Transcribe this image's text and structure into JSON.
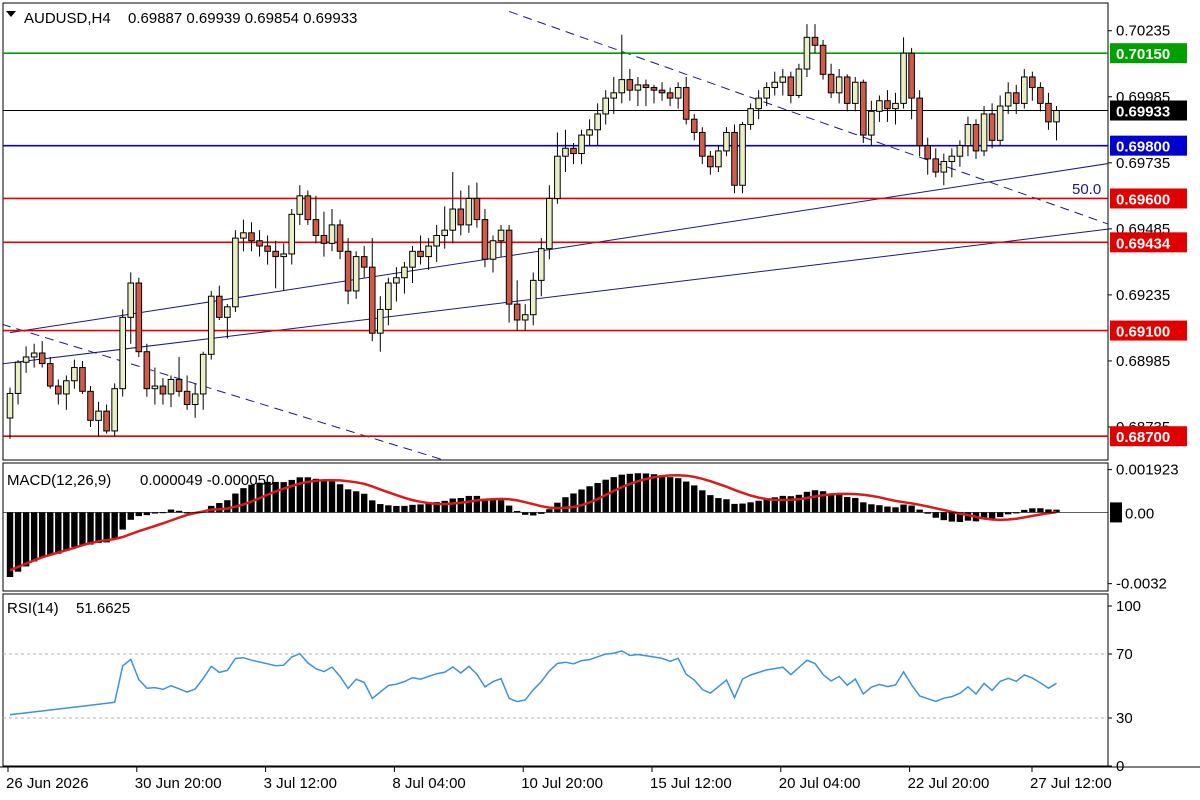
{
  "header": {
    "symbol": "AUDUSD,H4",
    "ohlc": "0.69887 0.69939 0.69854 0.69933",
    "menu_icon": "triangle-down-icon"
  },
  "colors": {
    "bull_body": "#e9efc6",
    "bear_body": "#cf5b49",
    "wick": "#000000",
    "resistance_line": "#e00000",
    "green_line": "#00a000",
    "blue_line": "#0000d0",
    "price_line": "#000000",
    "macd_signal": "#d81b1b",
    "rsi_line": "#3b93d9"
  },
  "chart_data": [
    {
      "type": "candlestick",
      "title": "AUDUSD,H4",
      "y_range": [
        0.6861,
        0.7034
      ],
      "y_ticks": [
        {
          "value": 0.70235,
          "label": "0.70235"
        },
        {
          "value": 0.69985,
          "label": "0.69985"
        },
        {
          "value": 0.69735,
          "label": "0.69735"
        },
        {
          "value": 0.69485,
          "label": "0.69485"
        },
        {
          "value": 0.69235,
          "label": "0.69235"
        },
        {
          "value": 0.68985,
          "label": "0.68985"
        },
        {
          "value": 0.68735,
          "label": "0.68735"
        }
      ],
      "x_labels": [
        "26 Jun 2026",
        "30 Jun 20:00",
        "3 Jul 12:00",
        "8 Jul 04:00",
        "10 Jul 20:00",
        "15 Jul 12:00",
        "20 Jul 04:00",
        "22 Jul 20:00",
        "27 Jul 12:00"
      ],
      "horizontal_levels": [
        {
          "value": 0.7015,
          "label": "0.70150",
          "color": "#00a000",
          "badge_bg": "#00a000",
          "badge_fg": "#ffffff"
        },
        {
          "value": 0.69933,
          "label": "0.69933",
          "color": "#000000",
          "badge_bg": "#000000",
          "badge_fg": "#ffffff"
        },
        {
          "value": 0.698,
          "label": "0.69800",
          "color": "#0000d0",
          "badge_bg": "#0000d0",
          "badge_fg": "#ffffff"
        },
        {
          "value": 0.696,
          "label": "0.69600",
          "color": "#e00000",
          "badge_bg": "#e00000",
          "badge_fg": "#ffffff"
        },
        {
          "value": 0.69434,
          "label": "0.69434",
          "color": "#e00000",
          "badge_bg": "#e00000",
          "badge_fg": "#ffffff"
        },
        {
          "value": 0.691,
          "label": "0.69100",
          "color": "#e00000",
          "badge_bg": "#e00000",
          "badge_fg": "#ffffff"
        },
        {
          "value": 0.687,
          "label": "0.68700",
          "color": "#e00000",
          "badge_bg": "#e00000",
          "badge_fg": "#ffffff"
        }
      ],
      "trend_lines": [
        {
          "from": [
            0,
            0.69092
          ],
          "to": [
            137,
            0.69735
          ],
          "color": "#1a1a80",
          "dash": false
        },
        {
          "from": [
            -2,
            0.6897
          ],
          "to": [
            144,
            0.69512
          ],
          "color": "#1a1a80",
          "dash": false,
          "note": "upper-channel hidden"
        },
        {
          "from": [
            62,
            0.70308
          ],
          "to": [
            138,
            0.69486
          ],
          "color": "#1a1a80",
          "dash": true
        },
        {
          "from": [
            -1,
            0.69124
          ],
          "to": [
            56,
            0.6859
          ],
          "color": "#1a1a80",
          "dash": true
        }
      ],
      "fib_label": "50.0",
      "candles": [
        [
          0.68769,
          0.68884,
          0.6869,
          0.68862
        ],
        [
          0.68862,
          0.68988,
          0.6882,
          0.6898
        ],
        [
          0.6898,
          0.6904,
          0.6894,
          0.69
        ],
        [
          0.69,
          0.6905,
          0.6896,
          0.69015
        ],
        [
          0.69015,
          0.6906,
          0.6896,
          0.68975
        ],
        [
          0.68975,
          0.69,
          0.6888,
          0.6889
        ],
        [
          0.6889,
          0.68915,
          0.6882,
          0.6886
        ],
        [
          0.6886,
          0.6893,
          0.688,
          0.6891
        ],
        [
          0.6891,
          0.6899,
          0.6888,
          0.6896
        ],
        [
          0.6896,
          0.68985,
          0.6886,
          0.6887
        ],
        [
          0.6887,
          0.6889,
          0.68735,
          0.6876
        ],
        [
          0.6876,
          0.6883,
          0.687,
          0.68795
        ],
        [
          0.68795,
          0.6882,
          0.6871,
          0.6872
        ],
        [
          0.6872,
          0.689,
          0.687,
          0.6888
        ],
        [
          0.6888,
          0.6918,
          0.6885,
          0.6915
        ],
        [
          0.6915,
          0.6932,
          0.6905,
          0.6928
        ],
        [
          0.6928,
          0.693,
          0.69,
          0.6902
        ],
        [
          0.6902,
          0.6905,
          0.6885,
          0.6888
        ],
        [
          0.6888,
          0.6896,
          0.6882,
          0.6889
        ],
        [
          0.6889,
          0.6892,
          0.6882,
          0.6886
        ],
        [
          0.6886,
          0.6893,
          0.6881,
          0.68915
        ],
        [
          0.68915,
          0.69,
          0.6885,
          0.6887
        ],
        [
          0.6887,
          0.6893,
          0.688,
          0.6882
        ],
        [
          0.6882,
          0.689,
          0.6877,
          0.6886
        ],
        [
          0.6886,
          0.6902,
          0.688,
          0.6901
        ],
        [
          0.6901,
          0.6925,
          0.6899,
          0.6923
        ],
        [
          0.6923,
          0.6927,
          0.6914,
          0.6915
        ],
        [
          0.6915,
          0.692,
          0.6907,
          0.6919
        ],
        [
          0.6919,
          0.6948,
          0.6917,
          0.6945
        ],
        [
          0.6945,
          0.6952,
          0.694,
          0.6947
        ],
        [
          0.6947,
          0.6951,
          0.694,
          0.6944
        ],
        [
          0.6944,
          0.6948,
          0.6938,
          0.6942
        ],
        [
          0.6942,
          0.6946,
          0.6935,
          0.694
        ],
        [
          0.694,
          0.6944,
          0.6926,
          0.6938
        ],
        [
          0.6938,
          0.6943,
          0.6925,
          0.6939
        ],
        [
          0.6939,
          0.6956,
          0.6935,
          0.6954
        ],
        [
          0.6954,
          0.6965,
          0.695,
          0.6961
        ],
        [
          0.6961,
          0.6963,
          0.695,
          0.6952
        ],
        [
          0.6952,
          0.6961,
          0.6943,
          0.6946
        ],
        [
          0.6946,
          0.6955,
          0.6938,
          0.6943
        ],
        [
          0.6943,
          0.6956,
          0.694,
          0.695
        ],
        [
          0.695,
          0.6952,
          0.6937,
          0.694
        ],
        [
          0.694,
          0.6945,
          0.692,
          0.6925
        ],
        [
          0.6925,
          0.694,
          0.6922,
          0.6938
        ],
        [
          0.6938,
          0.6942,
          0.693,
          0.6934
        ],
        [
          0.6934,
          0.6945,
          0.6906,
          0.6909
        ],
        [
          0.6909,
          0.6923,
          0.6902,
          0.6918
        ],
        [
          0.6918,
          0.693,
          0.6912,
          0.6928
        ],
        [
          0.6928,
          0.6934,
          0.6921,
          0.693
        ],
        [
          0.693,
          0.6936,
          0.6924,
          0.6934
        ],
        [
          0.6934,
          0.6942,
          0.6928,
          0.694
        ],
        [
          0.694,
          0.6946,
          0.6935,
          0.6938
        ],
        [
          0.6938,
          0.6945,
          0.6933,
          0.6942
        ],
        [
          0.6942,
          0.695,
          0.6936,
          0.6946
        ],
        [
          0.6946,
          0.6957,
          0.6941,
          0.6948
        ],
        [
          0.6948,
          0.697,
          0.6943,
          0.6956
        ],
        [
          0.6956,
          0.6963,
          0.6946,
          0.695
        ],
        [
          0.695,
          0.6965,
          0.6947,
          0.696
        ],
        [
          0.696,
          0.6966,
          0.6949,
          0.6952
        ],
        [
          0.6952,
          0.6956,
          0.6934,
          0.6937
        ],
        [
          0.6937,
          0.6946,
          0.6932,
          0.6944
        ],
        [
          0.6944,
          0.695,
          0.6938,
          0.6948
        ],
        [
          0.6948,
          0.695,
          0.6913,
          0.692
        ],
        [
          0.692,
          0.6929,
          0.691,
          0.6914
        ],
        [
          0.6914,
          0.692,
          0.691,
          0.6916
        ],
        [
          0.6916,
          0.6932,
          0.6912,
          0.6929
        ],
        [
          0.6929,
          0.6945,
          0.6923,
          0.6941
        ],
        [
          0.6941,
          0.6965,
          0.6937,
          0.696
        ],
        [
          0.696,
          0.6985,
          0.6958,
          0.6976
        ],
        [
          0.6976,
          0.6986,
          0.697,
          0.6979
        ],
        [
          0.6979,
          0.6981,
          0.6973,
          0.6977
        ],
        [
          0.6977,
          0.6986,
          0.6973,
          0.6984
        ],
        [
          0.6984,
          0.699,
          0.698,
          0.6986
        ],
        [
          0.6986,
          0.6996,
          0.698,
          0.6992
        ],
        [
          0.6992,
          0.7001,
          0.6988,
          0.6998
        ],
        [
          0.6998,
          0.7006,
          0.6992,
          0.7
        ],
        [
          0.7,
          0.7022,
          0.6996,
          0.7005
        ],
        [
          0.7005,
          0.7009,
          0.6997,
          0.7001
        ],
        [
          0.7001,
          0.7006,
          0.6995,
          0.7003
        ],
        [
          0.7003,
          0.7005,
          0.6995,
          0.7002
        ],
        [
          0.7002,
          0.7003,
          0.6996,
          0.7001
        ],
        [
          0.7001,
          0.7004,
          0.6997,
          0.7
        ],
        [
          0.7,
          0.7002,
          0.6995,
          0.6998
        ],
        [
          0.6998,
          0.7004,
          0.6994,
          0.7002
        ],
        [
          0.7002,
          0.7006,
          0.6988,
          0.699
        ],
        [
          0.699,
          0.6992,
          0.6982,
          0.6985
        ],
        [
          0.6985,
          0.6987,
          0.6973,
          0.6976
        ],
        [
          0.6976,
          0.6978,
          0.6969,
          0.6972
        ],
        [
          0.6972,
          0.698,
          0.697,
          0.6978
        ],
        [
          0.6978,
          0.6987,
          0.6976,
          0.6985
        ],
        [
          0.6985,
          0.6988,
          0.6962,
          0.6965
        ],
        [
          0.6965,
          0.6989,
          0.6962,
          0.6988
        ],
        [
          0.6988,
          0.6996,
          0.6986,
          0.6994
        ],
        [
          0.6994,
          0.7001,
          0.699,
          0.6998
        ],
        [
          0.6998,
          0.7004,
          0.6995,
          0.7002
        ],
        [
          0.7002,
          0.7008,
          0.6999,
          0.7004
        ],
        [
          0.7004,
          0.7009,
          0.6999,
          0.7006
        ],
        [
          0.7006,
          0.7008,
          0.6996,
          0.6999
        ],
        [
          0.6999,
          0.7011,
          0.6998,
          0.7009
        ],
        [
          0.7009,
          0.7026,
          0.7006,
          0.7021
        ],
        [
          0.7021,
          0.7026,
          0.7015,
          0.7018
        ],
        [
          0.7018,
          0.702,
          0.7005,
          0.7007
        ],
        [
          0.7007,
          0.7011,
          0.6998,
          0.7
        ],
        [
          0.7,
          0.7009,
          0.6996,
          0.7006
        ],
        [
          0.7006,
          0.7007,
          0.6993,
          0.6996
        ],
        [
          0.6996,
          0.7006,
          0.6993,
          0.7004
        ],
        [
          0.7004,
          0.7005,
          0.6981,
          0.6984
        ],
        [
          0.6984,
          0.6997,
          0.698,
          0.6993
        ],
        [
          0.6993,
          0.6999,
          0.6989,
          0.6997
        ],
        [
          0.6997,
          0.7001,
          0.6989,
          0.6994
        ],
        [
          0.6994,
          0.7,
          0.6988,
          0.6996
        ],
        [
          0.6996,
          0.7021,
          0.6994,
          0.7015
        ],
        [
          0.7015,
          0.7017,
          0.699,
          0.6998
        ],
        [
          0.6998,
          0.7001,
          0.6976,
          0.698
        ],
        [
          0.698,
          0.6983,
          0.6969,
          0.6975
        ],
        [
          0.6975,
          0.6979,
          0.6968,
          0.697
        ],
        [
          0.697,
          0.6977,
          0.6965,
          0.6974
        ],
        [
          0.6974,
          0.6979,
          0.6968,
          0.6976
        ],
        [
          0.6976,
          0.6982,
          0.6972,
          0.698
        ],
        [
          0.698,
          0.6991,
          0.6976,
          0.6988
        ],
        [
          0.6988,
          0.699,
          0.6975,
          0.6978
        ],
        [
          0.6978,
          0.6995,
          0.6976,
          0.6992
        ],
        [
          0.6992,
          0.6996,
          0.6979,
          0.6982
        ],
        [
          0.6982,
          0.6999,
          0.698,
          0.6995
        ],
        [
          0.6995,
          0.7004,
          0.6992,
          0.7
        ],
        [
          0.7,
          0.7003,
          0.6992,
          0.6996
        ],
        [
          0.6996,
          0.7009,
          0.6994,
          0.7006
        ],
        [
          0.7006,
          0.7008,
          0.6997,
          0.7002
        ],
        [
          0.7002,
          0.7004,
          0.6993,
          0.6996
        ],
        [
          0.6996,
          0.7,
          0.6986,
          0.6989
        ],
        [
          0.6989,
          0.6995,
          0.6982,
          0.69933
        ]
      ]
    },
    {
      "type": "bar",
      "title": "MACD(12,26,9)",
      "values_text": "0.000049 -0.000050",
      "y_range": [
        -0.00353,
        0.00222
      ],
      "y_ticks": [
        {
          "value": 0.001923,
          "label": "0.001923"
        },
        {
          "value": -0.0032,
          "label": "-0.0032"
        }
      ],
      "zero_label": "0.00",
      "signal": [],
      "histogram": []
    },
    {
      "type": "line",
      "title": "RSI(14)",
      "value_text": "51.6625",
      "y_range": [
        0,
        100
      ],
      "y_ticks": [
        {
          "value": 100,
          "label": "100"
        },
        {
          "value": 70,
          "label": "70"
        },
        {
          "value": 30,
          "label": "30"
        },
        {
          "value": 0,
          "label": "0"
        }
      ],
      "levels": [
        70,
        30
      ],
      "series": []
    }
  ]
}
